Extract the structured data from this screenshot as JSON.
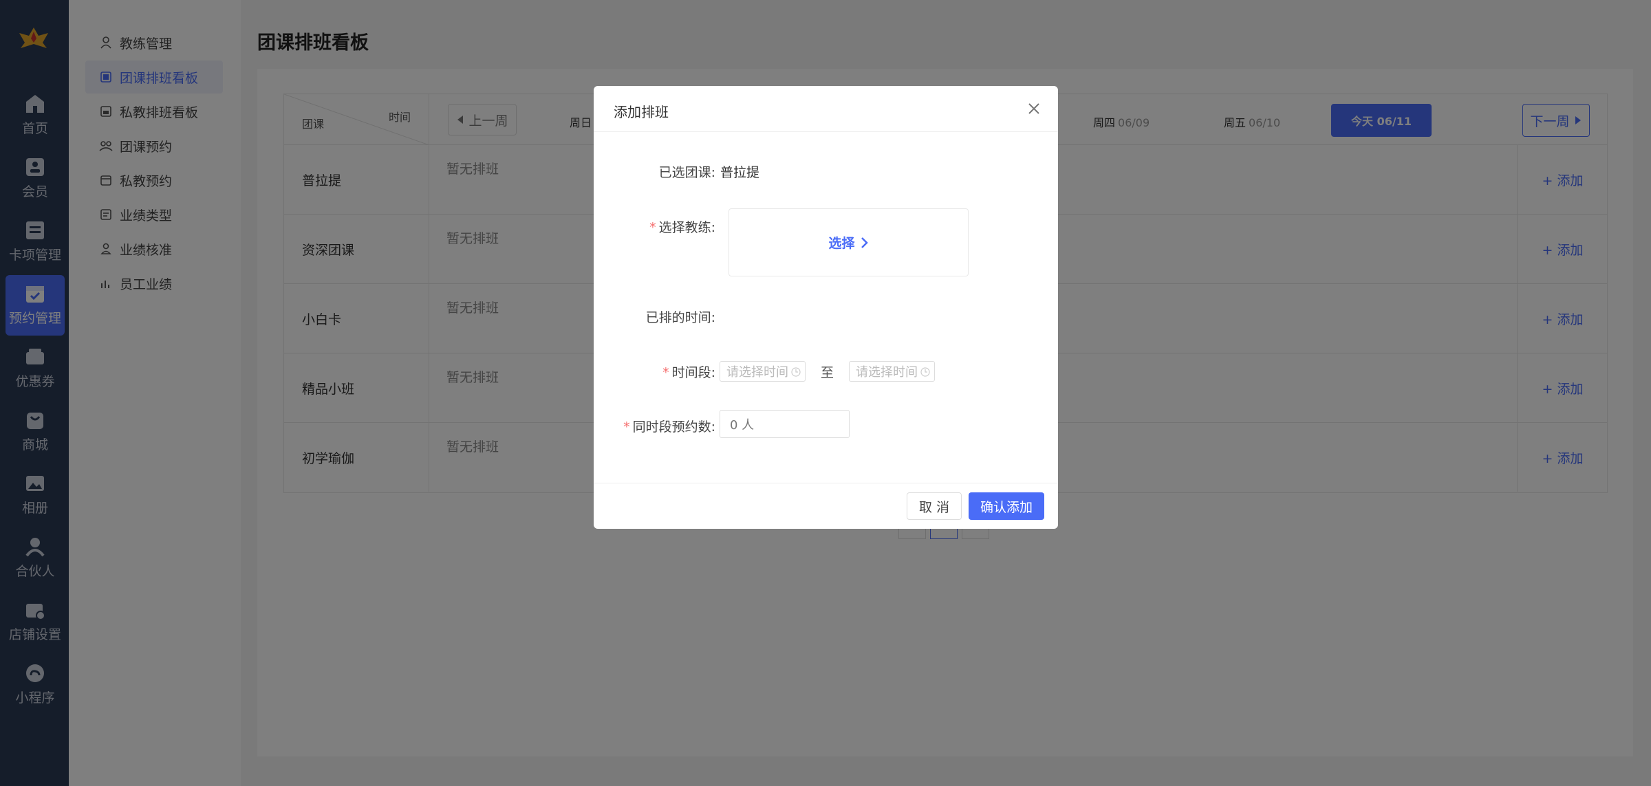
{
  "colors": {
    "accent": "#4a6cf7",
    "rail_bg": "#2b3a55",
    "required": "#f56c6c"
  },
  "rail": {
    "items": [
      {
        "label": "首页",
        "icon": "home-icon"
      },
      {
        "label": "会员",
        "icon": "member-card-icon"
      },
      {
        "label": "卡项管理",
        "icon": "card-list-icon"
      },
      {
        "label": "预约管理",
        "icon": "calendar-check-icon",
        "active": true
      },
      {
        "label": "优惠券",
        "icon": "coupon-icon"
      },
      {
        "label": "商城",
        "icon": "shop-bag-icon"
      },
      {
        "label": "相册",
        "icon": "photo-icon"
      },
      {
        "label": "合伙人",
        "icon": "partner-icon"
      },
      {
        "label": "店铺设置",
        "icon": "store-settings-icon"
      },
      {
        "label": "小程序",
        "icon": "mini-program-icon"
      }
    ]
  },
  "submenu": {
    "items": [
      {
        "label": "教练管理",
        "icon": "user-icon"
      },
      {
        "label": "团课排班看板",
        "icon": "board-icon",
        "active": true
      },
      {
        "label": "私教排班看板",
        "icon": "board-icon"
      },
      {
        "label": "团课预约",
        "icon": "group-icon"
      },
      {
        "label": "私教预约",
        "icon": "calendar-icon"
      },
      {
        "label": "业绩类型",
        "icon": "list-icon"
      },
      {
        "label": "业绩核准",
        "icon": "user-check-icon"
      },
      {
        "label": "员工业绩",
        "icon": "bar-chart-icon"
      }
    ]
  },
  "page": {
    "title": "团课排班看板"
  },
  "board": {
    "corner": {
      "time": "时间",
      "course": "团课"
    },
    "prev_week": "上一周",
    "next_week": "下一周",
    "days": [
      {
        "day": "周日",
        "date": ""
      },
      {
        "day": "周四",
        "date": "06/09"
      },
      {
        "day": "周五",
        "date": "06/10"
      }
    ],
    "today": "今天 06/11",
    "empty_text": "暂无排班",
    "add_label": "+ 添加",
    "rows": [
      {
        "course": "普拉提"
      },
      {
        "course": "资深团课"
      },
      {
        "course": "小白卡"
      },
      {
        "course": "精品小班"
      },
      {
        "course": "初学瑜伽"
      }
    ]
  },
  "modal": {
    "title": "添加排班",
    "selected_course_label": "已选团课:",
    "selected_course_value": "普拉提",
    "coach_label": "选择教练:",
    "coach_button": "选择",
    "scheduled_time_label": "已排的时间:",
    "time_range_label": "时间段:",
    "start_placeholder": "请选择时间",
    "to_text": "至",
    "end_placeholder": "请选择时间",
    "capacity_label": "同时段预约数:",
    "capacity_value": "0 人",
    "cancel": "取 消",
    "confirm": "确认添加"
  }
}
